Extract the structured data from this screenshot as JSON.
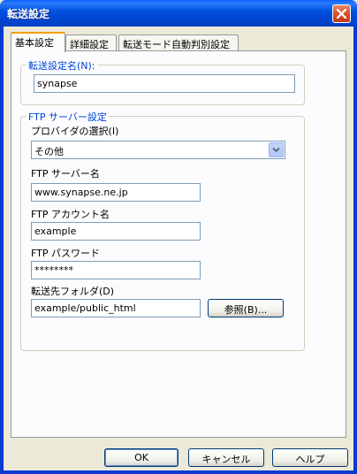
{
  "window": {
    "title": "転送設定"
  },
  "tabs": [
    {
      "label": "基本設定",
      "active": true
    },
    {
      "label": "詳細設定",
      "active": false
    },
    {
      "label": "転送モード自動判別設定",
      "active": false
    }
  ],
  "transfer_name": {
    "group_label": "転送設定名(N):",
    "value": "synapse"
  },
  "ftp_settings": {
    "group_label": "FTP サーバー設定",
    "provider_label": "プロバイダの選択(I)",
    "provider_value": "その他",
    "server_label": "FTP サーバー名",
    "server_value": "www.synapse.ne.jp",
    "account_label": "FTP アカウント名",
    "account_value": "example",
    "password_label": "FTP パスワード",
    "password_value": "********",
    "folder_label": "転送先フォルダ(D)",
    "folder_value": "example/public_html",
    "browse_label": "参照(B)..."
  },
  "buttons": {
    "ok": "OK",
    "cancel": "キャンセル",
    "help": "ヘルプ"
  },
  "colors": {
    "title_bar": "#0054e3",
    "group_label": "#0046d5",
    "dialog_bg": "#ece9d8"
  }
}
